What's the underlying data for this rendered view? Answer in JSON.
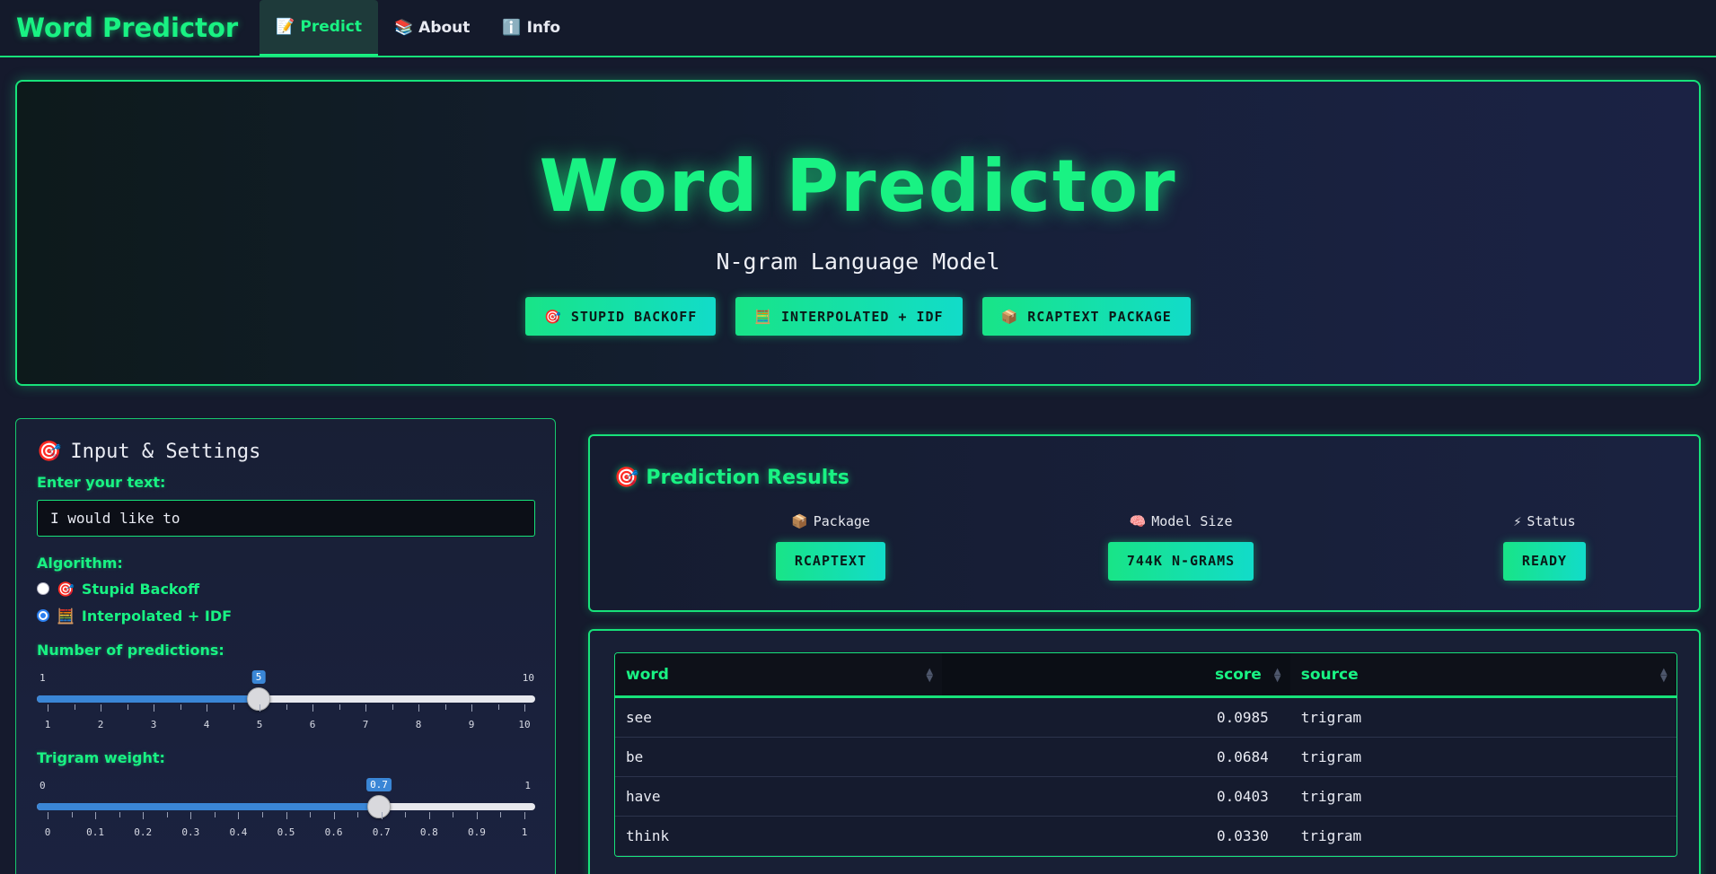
{
  "navbar": {
    "brand": "Word Predictor",
    "tabs": [
      {
        "icon": "📝",
        "label": "Predict"
      },
      {
        "icon": "📚",
        "label": "About"
      },
      {
        "icon": "ℹ️",
        "label": "Info"
      }
    ]
  },
  "hero": {
    "title": "Word Predictor",
    "subtitle": "N-gram Language Model",
    "badges": [
      {
        "icon": "🎯",
        "label": "STUPID BACKOFF"
      },
      {
        "icon": "🧮",
        "label": "INTERPOLATED + IDF"
      },
      {
        "icon": "📦",
        "label": "RCAPTEXT PACKAGE"
      }
    ]
  },
  "settings": {
    "title_icon": "🎯",
    "title": "Input & Settings",
    "text_label": "Enter your text:",
    "text_value": "I would like to",
    "algorithm_label": "Algorithm:",
    "algorithms": [
      {
        "icon": "🎯",
        "label": "Stupid Backoff",
        "checked": false
      },
      {
        "icon": "🧮",
        "label": "Interpolated + IDF",
        "checked": true
      }
    ],
    "num_predictions": {
      "label": "Number of predictions:",
      "min": "1",
      "max": "10",
      "value": "5",
      "ticks": [
        "1",
        "2",
        "3",
        "4",
        "5",
        "6",
        "7",
        "8",
        "9",
        "10"
      ]
    },
    "trigram_weight": {
      "label": "Trigram weight:",
      "min": "0",
      "max": "1",
      "value": "0.7",
      "ticks": [
        "0",
        "0.1",
        "0.2",
        "0.3",
        "0.4",
        "0.5",
        "0.6",
        "0.7",
        "0.8",
        "0.9",
        "1"
      ]
    }
  },
  "results": {
    "title_icon": "🎯",
    "title": "Prediction Results",
    "stats": [
      {
        "icon": "📦",
        "label": "Package",
        "value": "RCAPTEXT"
      },
      {
        "icon": "🧠",
        "label": "Model Size",
        "value": "744K N-GRAMS"
      },
      {
        "icon": "⚡",
        "label": "Status",
        "value": "READY"
      }
    ]
  },
  "table": {
    "columns": [
      "word",
      "score",
      "source"
    ],
    "rows": [
      {
        "word": "see",
        "score": "0.0985",
        "source": "trigram"
      },
      {
        "word": "be",
        "score": "0.0684",
        "source": "trigram"
      },
      {
        "word": "have",
        "score": "0.0403",
        "source": "trigram"
      },
      {
        "word": "think",
        "score": "0.0330",
        "source": "trigram"
      }
    ]
  },
  "colors": {
    "accent": "#19f283",
    "badge_gradient_start": "#18e487",
    "badge_gradient_end": "#12dcc9",
    "slider_fill": "#3a86d6",
    "background": "#151a2d"
  }
}
